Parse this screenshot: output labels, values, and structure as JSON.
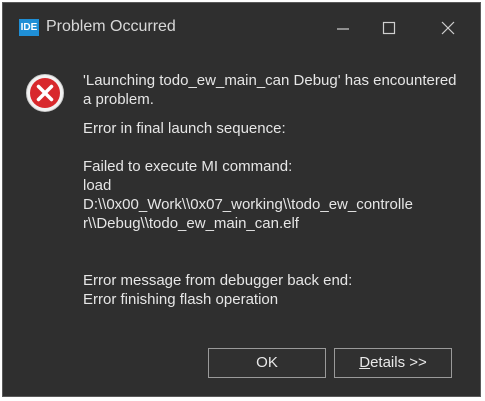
{
  "window": {
    "title": "Problem Occurred",
    "app_icon_label": "IDE",
    "icons": {
      "minimize": "minimize-icon",
      "maximize": "maximize-icon",
      "close": "close-icon",
      "error": "error-icon"
    }
  },
  "message": {
    "headline_line1": "'Launching todo_ew_main_can Debug' has encountered",
    "headline_line2": "a problem.",
    "error_summary": "Error in final launch sequence:",
    "detail_line1": "Failed to execute MI command:",
    "detail_line2": "load",
    "detail_line3": "D:\\\\0x00_Work\\\\0x07_working\\\\todo_ew_controlle",
    "detail_line4": "r\\\\Debug\\\\todo_ew_main_can.elf",
    "debugger_line1": "Error message from debugger back end:",
    "debugger_line2": "Error finishing flash operation"
  },
  "buttons": {
    "ok_label": "OK",
    "details_mnemonic": "D",
    "details_rest": "etails >>"
  },
  "colors": {
    "dialog_background": "#2f2f2f",
    "text": "#e6e6e6",
    "app_icon": "#1f8fd6",
    "error_red": "#d8282c"
  }
}
